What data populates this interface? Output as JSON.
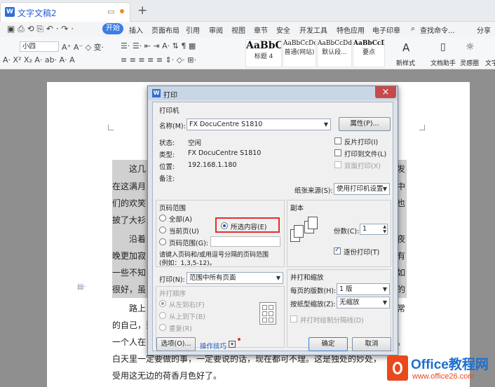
{
  "titlebar": {
    "doc_tab": "文字文稿2",
    "plus": "+"
  },
  "menu": {
    "items": [
      "开始",
      "插入",
      "页面布局",
      "引用",
      "审阅",
      "视图",
      "章节",
      "安全",
      "开发工具",
      "特色应用",
      "电子印章"
    ],
    "search": "查找命令...",
    "share": "分享"
  },
  "ribbon": {
    "font_size": "小四",
    "styles": [
      {
        "preview": "AaBbC",
        "name": "标题 4"
      },
      {
        "preview": "AaBbCcDd",
        "name": "普通(网站)"
      },
      {
        "preview": "AaBbCcDd",
        "name": "默认段..."
      },
      {
        "preview": "AaBbCcDd",
        "name": "要点"
      }
    ],
    "new_style": "新样式",
    "doc_helper": "文档助手",
    "inspire": "灵感圈",
    "text": "文字"
  },
  "document": {
    "lines": [
      "这几",
      "在这满月",
      "们的欢笑",
      "披了大衫",
      "沿着",
      "晚更加寂",
      "一些不知",
      "很好，虽",
      "路上",
      "的自己，到",
      "一个人在",
      "白天里一定要做的事，一定要说的话，现在都可不理。这是独处的妙处，",
      "受用这无边的荷香月色好了。"
    ]
  },
  "dialog": {
    "title": "打印",
    "printer_section": "打印机",
    "name_label": "名称(M):",
    "printer_name": "FX DocuCentre S1810",
    "properties": "属性(P)...",
    "status_label": "状态:",
    "status_value": "空闲",
    "type_label": "类型:",
    "type_value": "FX DocuCentre S1810",
    "location_label": "位置:",
    "location_value": "192.168.1.180",
    "comment_label": "备注:",
    "reverse_print": "反片打印(I)",
    "print_to_file": "打印到文件(L)",
    "duplex": "双面打印(X)",
    "paper_source_label": "纸张来源(S):",
    "paper_source_value": "使用打印机设置",
    "range_section": "页码范围",
    "all": "全部(A)",
    "current": "当前页(U)",
    "selection": "所选内容(E)",
    "pages": "页码范围(G):",
    "range_hint1": "请键入页码和/或用逗号分隔的页码范围",
    "range_hint2": "(例如：1,3,5-12)。",
    "copies_section": "副本",
    "copies_label": "份数(C):",
    "copies_value": "1",
    "collate": "逐份打印(T)",
    "print_label": "打印(N):",
    "print_value": "范围中所有页面",
    "order_section": "并打顺序",
    "order1": "从左到右(F)",
    "order2": "从上到下(B)",
    "order3": "重复(R)",
    "zoom_section": "并打和缩放",
    "pages_per_sheet_label": "每页的版数(H):",
    "pages_per_sheet_value": "1 版",
    "scale_label": "按纸型缩放(Z):",
    "scale_value": "无缩放",
    "separator": "并打时绘制分隔线(D)",
    "options": "选项(O)...",
    "tips": "操作技巧",
    "ok": "确定",
    "cancel": "取消"
  },
  "logo": {
    "brand": "Office教程网",
    "url": "www.office26.com"
  }
}
